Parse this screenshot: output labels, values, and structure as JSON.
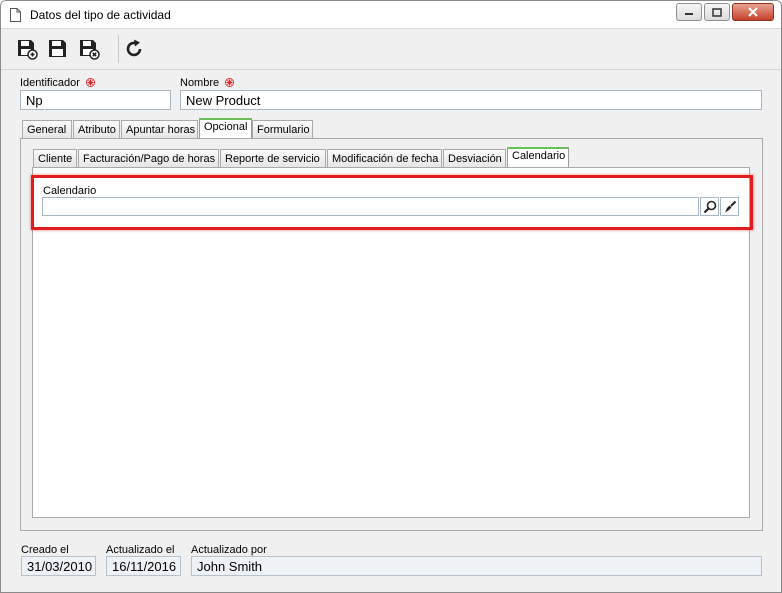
{
  "window": {
    "title": "Datos del tipo de actividad",
    "icons": [
      "document-icon",
      "minimize-icon",
      "maximize-icon",
      "close-icon"
    ]
  },
  "toolbar": {
    "icons": [
      "save-new-icon",
      "save-icon",
      "save-close-icon",
      "refresh-icon"
    ]
  },
  "form": {
    "identificador_label": "Identificador",
    "identificador_value": "Np",
    "nombre_label": "Nombre",
    "nombre_value": "New Product",
    "required_color": "#d92b2b"
  },
  "tabs": [
    {
      "label": "General"
    },
    {
      "label": "Atributo"
    },
    {
      "label": "Apuntar horas"
    },
    {
      "label": "Opcional"
    },
    {
      "label": "Formulario"
    }
  ],
  "subtabs": [
    {
      "label": "Cliente"
    },
    {
      "label": "Facturación/Pago de horas"
    },
    {
      "label": "Reporte de servicio"
    },
    {
      "label": "Modificación de fecha"
    },
    {
      "label": "Desviación"
    },
    {
      "label": "Calendario"
    }
  ],
  "calendario": {
    "label": "Calendario",
    "value": "",
    "icons": [
      "search-icon",
      "clear-brush-icon"
    ]
  },
  "footer": {
    "creado_label": "Creado el",
    "creado_value": "31/03/2010",
    "actualizado_label": "Actualizado el",
    "actualizado_value": "16/11/2016",
    "por_label": "Actualizado por",
    "por_value": "John Smith"
  },
  "colors": {
    "active_tab_accent": "#6bbf5a",
    "highlight": "#e31b1b"
  }
}
